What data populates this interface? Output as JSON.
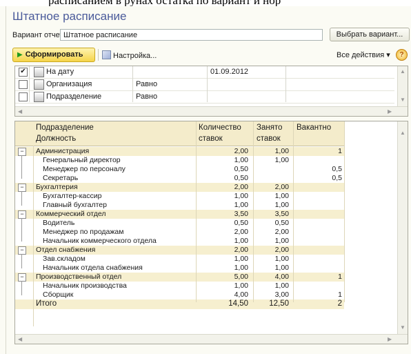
{
  "top_fragment": "расписанием в рунах остатка по вариант и нор",
  "window": {
    "title": "Штатное расписание"
  },
  "variant": {
    "label": "Вариант отчета:",
    "value": "Штатное расписание",
    "select_button": "Выбрать вариант..."
  },
  "toolbar": {
    "generate": "Сформировать",
    "settings": "Настройка...",
    "all_actions": "Все действия",
    "help": "?"
  },
  "filters": [
    {
      "checked": true,
      "name": "На дату",
      "condition": "",
      "value": "01.09.2012"
    },
    {
      "checked": false,
      "name": "Организация",
      "condition": "Равно",
      "value": ""
    },
    {
      "checked": false,
      "name": "Подразделение",
      "condition": "Равно",
      "value": ""
    }
  ],
  "table": {
    "headers": {
      "dept": "Подразделение",
      "pos": "Должность",
      "qty1": "Количество",
      "qty2": "ставок",
      "occ1": "Занято",
      "occ2": "ставок",
      "vac": "Вакантно"
    },
    "rows": [
      {
        "group": true,
        "name": "Администрация",
        "qty": "2,00",
        "occ": "1,00",
        "vac": "1"
      },
      {
        "group": false,
        "name": "Генеральный директор",
        "qty": "1,00",
        "occ": "1,00",
        "vac": ""
      },
      {
        "group": false,
        "name": "Менеджер по персоналу",
        "qty": "0,50",
        "occ": "",
        "vac": "0,5"
      },
      {
        "group": false,
        "name": "Секретарь",
        "qty": "0,50",
        "occ": "",
        "vac": "0,5"
      },
      {
        "group": true,
        "name": "Бухгалтерия",
        "qty": "2,00",
        "occ": "2,00",
        "vac": ""
      },
      {
        "group": false,
        "name": "Бухгалтер-кассир",
        "qty": "1,00",
        "occ": "1,00",
        "vac": ""
      },
      {
        "group": false,
        "name": "Главный бухгалтер",
        "qty": "1,00",
        "occ": "1,00",
        "vac": ""
      },
      {
        "group": true,
        "name": "Коммерческий отдел",
        "qty": "3,50",
        "occ": "3,50",
        "vac": ""
      },
      {
        "group": false,
        "name": "Водитель",
        "qty": "0,50",
        "occ": "0,50",
        "vac": ""
      },
      {
        "group": false,
        "name": "Менеджер по продажам",
        "qty": "2,00",
        "occ": "2,00",
        "vac": ""
      },
      {
        "group": false,
        "name": "Начальник коммерческого отдела",
        "qty": "1,00",
        "occ": "1,00",
        "vac": ""
      },
      {
        "group": true,
        "name": "Отдел снабжения",
        "qty": "2,00",
        "occ": "2,00",
        "vac": ""
      },
      {
        "group": false,
        "name": "Зав.складом",
        "qty": "1,00",
        "occ": "1,00",
        "vac": ""
      },
      {
        "group": false,
        "name": "Начальник отдела снабжения",
        "qty": "1,00",
        "occ": "1,00",
        "vac": ""
      },
      {
        "group": true,
        "name": "Производственный отдел",
        "qty": "5,00",
        "occ": "4,00",
        "vac": "1"
      },
      {
        "group": false,
        "name": "Начальник производства",
        "qty": "1,00",
        "occ": "1,00",
        "vac": ""
      },
      {
        "group": false,
        "name": "Сборщик",
        "qty": "4,00",
        "occ": "3,00",
        "vac": "1"
      }
    ],
    "total": {
      "label": "Итого",
      "qty": "14,50",
      "occ": "12,50",
      "vac": "2"
    }
  },
  "colors": {
    "title": "#4a5a9a",
    "header_bg": "#f4eccb",
    "group_bg": "#f6efcf",
    "generate_btn": "#f5d44a"
  }
}
